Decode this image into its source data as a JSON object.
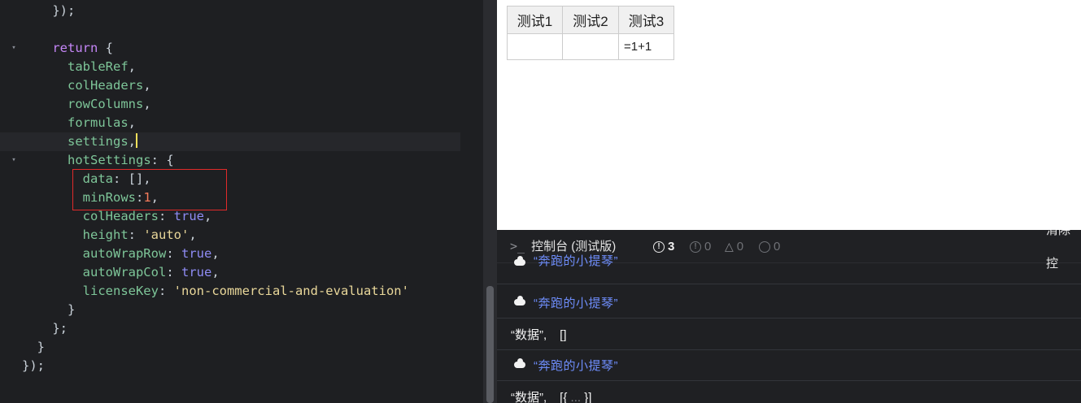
{
  "editor": {
    "lines": [
      {
        "tokens": [
          {
            "t": "    ",
            "c": "punc"
          },
          {
            "t": "});",
            "c": "punc"
          }
        ]
      },
      {
        "tokens": []
      },
      {
        "fold": true,
        "tokens": [
          {
            "t": "    ",
            "c": "punc"
          },
          {
            "t": "return",
            "c": "kw"
          },
          {
            "t": " {",
            "c": "punc"
          }
        ]
      },
      {
        "tokens": [
          {
            "t": "      ",
            "c": "punc"
          },
          {
            "t": "tableRef",
            "c": "prop"
          },
          {
            "t": ",",
            "c": "punc"
          }
        ]
      },
      {
        "tokens": [
          {
            "t": "      ",
            "c": "punc"
          },
          {
            "t": "colHeaders",
            "c": "prop"
          },
          {
            "t": ",",
            "c": "punc"
          }
        ]
      },
      {
        "tokens": [
          {
            "t": "      ",
            "c": "punc"
          },
          {
            "t": "rowColumns",
            "c": "prop"
          },
          {
            "t": ",",
            "c": "punc"
          }
        ]
      },
      {
        "tokens": [
          {
            "t": "      ",
            "c": "punc"
          },
          {
            "t": "formulas",
            "c": "prop"
          },
          {
            "t": ",",
            "c": "punc"
          }
        ]
      },
      {
        "current": true,
        "caret": true,
        "tokens": [
          {
            "t": "      ",
            "c": "punc"
          },
          {
            "t": "settings",
            "c": "prop"
          },
          {
            "t": ",",
            "c": "punc"
          }
        ]
      },
      {
        "fold": true,
        "tokens": [
          {
            "t": "      ",
            "c": "punc"
          },
          {
            "t": "hotSettings",
            "c": "prop"
          },
          {
            "t": ": {",
            "c": "punc"
          }
        ]
      },
      {
        "tokens": [
          {
            "t": "        ",
            "c": "punc"
          },
          {
            "t": "data",
            "c": "key"
          },
          {
            "t": ": [],",
            "c": "punc"
          }
        ]
      },
      {
        "tokens": [
          {
            "t": "        ",
            "c": "punc"
          },
          {
            "t": "minRows",
            "c": "key"
          },
          {
            "t": ":",
            "c": "punc"
          },
          {
            "t": "1",
            "c": "num"
          },
          {
            "t": ",",
            "c": "punc"
          }
        ]
      },
      {
        "tokens": [
          {
            "t": "        ",
            "c": "punc"
          },
          {
            "t": "colHeaders",
            "c": "key"
          },
          {
            "t": ": ",
            "c": "punc"
          },
          {
            "t": "true",
            "c": "bool"
          },
          {
            "t": ",",
            "c": "punc"
          }
        ]
      },
      {
        "tokens": [
          {
            "t": "        ",
            "c": "punc"
          },
          {
            "t": "height",
            "c": "key"
          },
          {
            "t": ": ",
            "c": "punc"
          },
          {
            "t": "'auto'",
            "c": "str"
          },
          {
            "t": ",",
            "c": "punc"
          }
        ]
      },
      {
        "tokens": [
          {
            "t": "        ",
            "c": "punc"
          },
          {
            "t": "autoWrapRow",
            "c": "key"
          },
          {
            "t": ": ",
            "c": "punc"
          },
          {
            "t": "true",
            "c": "bool"
          },
          {
            "t": ",",
            "c": "punc"
          }
        ]
      },
      {
        "tokens": [
          {
            "t": "        ",
            "c": "punc"
          },
          {
            "t": "autoWrapCol",
            "c": "key"
          },
          {
            "t": ": ",
            "c": "punc"
          },
          {
            "t": "true",
            "c": "bool"
          },
          {
            "t": ",",
            "c": "punc"
          }
        ]
      },
      {
        "tokens": [
          {
            "t": "        ",
            "c": "punc"
          },
          {
            "t": "licenseKey",
            "c": "key"
          },
          {
            "t": ": ",
            "c": "punc"
          },
          {
            "t": "'non-commercial-and-evaluation'",
            "c": "str"
          }
        ]
      },
      {
        "tokens": [
          {
            "t": "      ",
            "c": "punc"
          },
          {
            "t": "}",
            "c": "punc"
          }
        ]
      },
      {
        "tokens": [
          {
            "t": "    ",
            "c": "punc"
          },
          {
            "t": "};",
            "c": "punc"
          }
        ]
      },
      {
        "tokens": [
          {
            "t": "  ",
            "c": "punc"
          },
          {
            "t": "}",
            "c": "punc"
          }
        ]
      },
      {
        "tokens": [
          {
            "t": "});",
            "c": "punc"
          }
        ]
      }
    ]
  },
  "preview": {
    "table": {
      "headers": [
        "测试1",
        "测试2",
        "测试3"
      ],
      "rows": [
        [
          "",
          "",
          "=1+1"
        ]
      ]
    }
  },
  "console": {
    "title": "控制台 (测试版)",
    "prompt_icon": "terminal-prompt-icon",
    "error_count": "3",
    "info_count": "0",
    "warning_count": "0",
    "other_count": "0",
    "clear_label": "清除控",
    "logs": [
      {
        "type": "str",
        "icon": "cloud-icon",
        "text": "“奔跑的小提琴”"
      },
      {
        "type": "str",
        "icon": "cloud-icon",
        "text": "“奔跑的小提琴”"
      },
      {
        "type": "plain",
        "label": "“数据”,",
        "value": "[]",
        "dots": ""
      },
      {
        "type": "str",
        "icon": "cloud-icon",
        "text": "“奔跑的小提琴”"
      },
      {
        "type": "plain",
        "label": "“数据”,",
        "value": "[{",
        "dots": " ... ",
        "close": "}]"
      }
    ]
  }
}
